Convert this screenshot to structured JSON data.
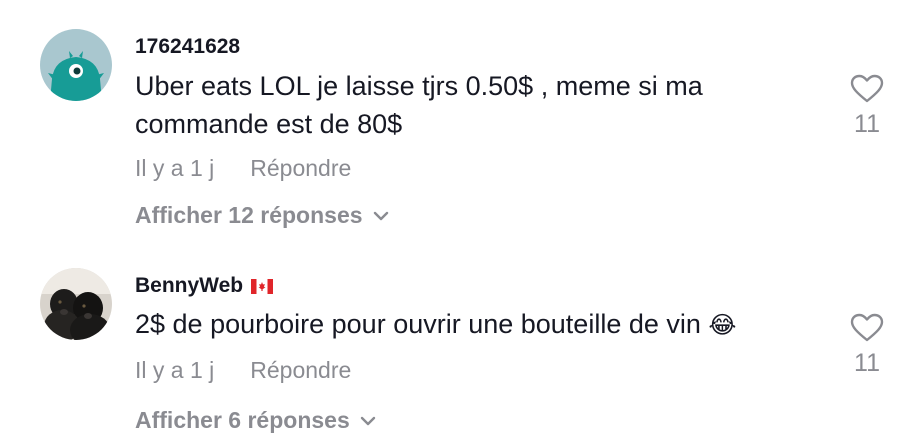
{
  "comments": [
    {
      "username": "176241628",
      "text": "Uber eats LOL je laisse tjrs 0.50$ , meme si ma commande est de 80$",
      "time": "Il y a 1 j",
      "reply_label": "Répondre",
      "view_replies": "Afficher 12 réponses",
      "likes": "11",
      "avatar_icon": "teal-monster-avatar",
      "colors": {
        "avatar_bg": "#a9c7cf",
        "avatar_fg": "#179c96"
      }
    },
    {
      "username": "BennyWeb",
      "flag": "canada-flag-icon",
      "text": "2$ de pourboire pour ouvrir une bouteille de vin",
      "emoji": "😂",
      "time": "Il y a 1 j",
      "reply_label": "Répondre",
      "view_replies": "Afficher 6 réponses",
      "likes": "11",
      "avatar_icon": "dogs-photo-avatar"
    }
  ],
  "colors": {
    "text": "#161823",
    "muted": "#8a8b91",
    "background": "#ffffff"
  }
}
